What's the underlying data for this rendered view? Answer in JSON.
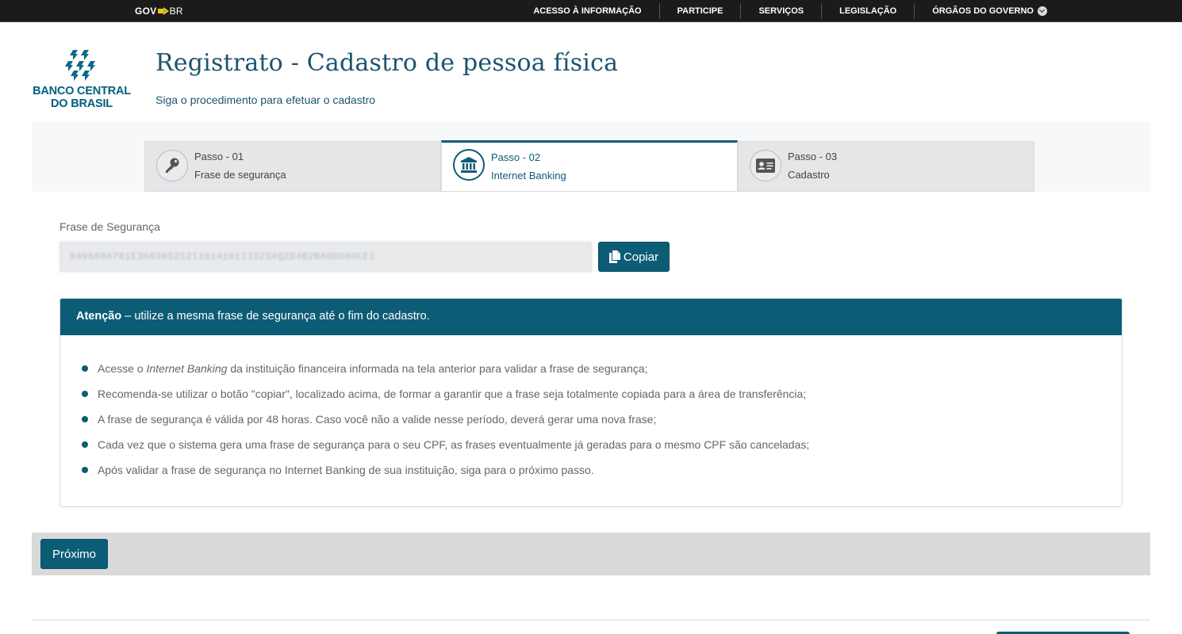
{
  "govbar": {
    "logo_gov": "GOV",
    "logo_br": "BR",
    "nav": [
      "ACESSO À INFORMAÇÃO",
      "PARTICIPE",
      "SERVIÇOS",
      "LEGISLAÇÃO",
      "ÓRGÃOS DO GOVERNO"
    ]
  },
  "header": {
    "logo_line1": "BANCO CENTRAL",
    "logo_line2": "DO BRASIL",
    "title": "Registrato - Cadastro de pessoa física",
    "subtitle": "Siga o procedimento para efetuar o cadastro"
  },
  "steps": [
    {
      "title": "Passo - 01",
      "label": "Frase de segurança",
      "icon": "key-icon",
      "active": false
    },
    {
      "title": "Passo - 02",
      "label": "Internet Banking",
      "icon": "bank-icon",
      "active": true
    },
    {
      "title": "Passo - 03",
      "label": "Cadastro",
      "icon": "id-card-icon",
      "active": false
    }
  ],
  "phrase": {
    "label": "Frase de Segurança",
    "value": "0495888761E3603052521101410113325XQZD4B2BA0DD60CE1",
    "copy_label": "Copiar"
  },
  "alert": {
    "title_bold": "Atenção",
    "title_rest": " – utilize a mesma frase de segurança até o fim do cadastro.",
    "item1_pre": "Acesse o ",
    "item1_em": "Internet Banking",
    "item1_post": " da instituição financeira informada na tela anterior para validar a frase de segurança;",
    "item2": "Recomenda-se utilizar o botão \"copiar\", localizado acima, de formar a garantir que a frase seja totalmente copiada para a área de transferência;",
    "item3": "A frase de segurança é válida por 48 horas. Caso você não a valide nesse período, deverá gerar uma nova frase;",
    "item4": "Cada vez que o sistema gera uma frase de segurança para o seu CPF, as frases eventualmente já geradas para o mesmo CPF são canceladas;",
    "item5": "Após validar a frase de segurança no Internet Banking de sua instituição, siga para o próximo passo."
  },
  "footer": {
    "next_label": "Próximo"
  },
  "colors": {
    "primary": "#0d5c76",
    "govbar": "#1b1b1b",
    "title": "#1c5470"
  }
}
